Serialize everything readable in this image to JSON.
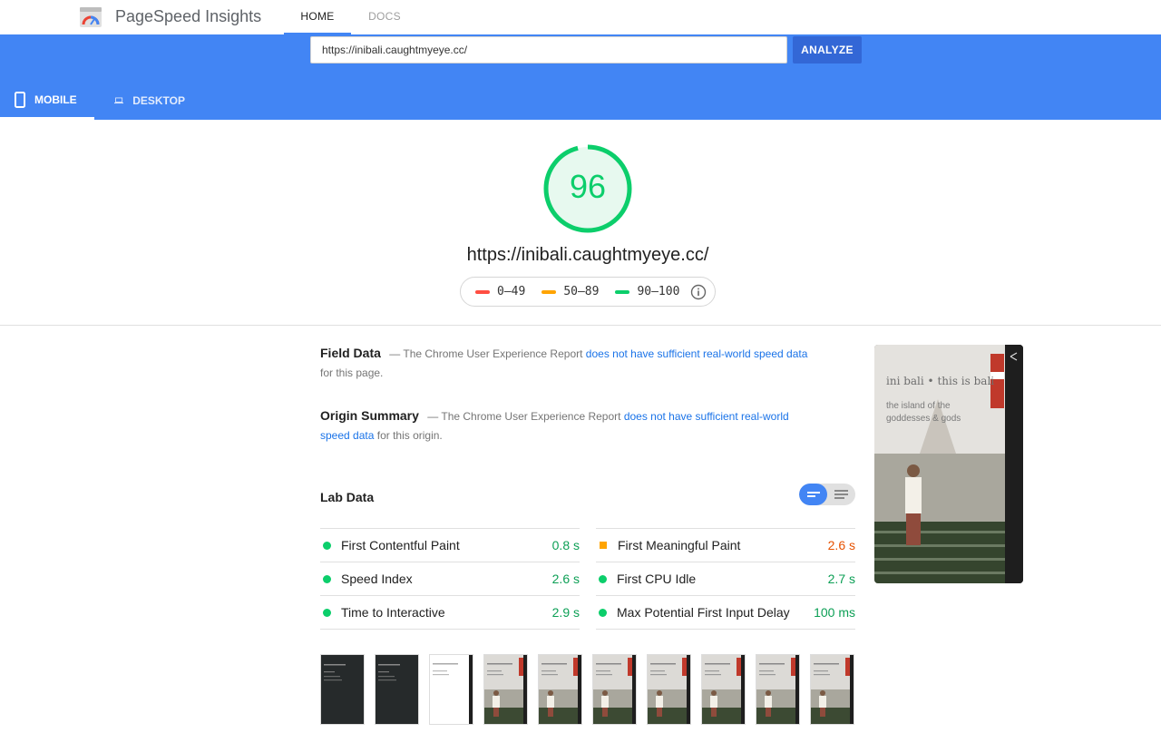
{
  "header": {
    "app_title": "PageSpeed Insights",
    "tabs": [
      {
        "label": "HOME"
      },
      {
        "label": "DOCS"
      }
    ]
  },
  "search": {
    "url_value": "https://inibali.caughtmyeye.cc/",
    "analyze_label": "ANALYZE"
  },
  "device_tabs": [
    {
      "label": "MOBILE",
      "icon": "smartphone-icon",
      "selected": true
    },
    {
      "label": "DESKTOP",
      "icon": "laptop-icon",
      "selected": false
    }
  ],
  "score": {
    "value": "96",
    "fraction": 0.96,
    "color": "#0cce6b",
    "tested_url": "https://inibali.caughtmyeye.cc/"
  },
  "legend": [
    {
      "label": "0–49",
      "color": "#ff4e42"
    },
    {
      "label": "50–89",
      "color": "#ffa400"
    },
    {
      "label": "90–100",
      "color": "#0cce6b"
    }
  ],
  "field_data": {
    "heading": "Field Data",
    "text_before": "— The Chrome User Experience Report",
    "link": "does not have sufficient real-world speed data",
    "text_after": "for this page."
  },
  "origin_summary": {
    "heading": "Origin Summary",
    "text_before": "— The Chrome User Experience Report",
    "link": "does not have sufficient real-world speed data",
    "text_after": "for this origin."
  },
  "lab_data": {
    "heading": "Lab Data",
    "metrics_left": [
      {
        "name": "First Contentful Paint",
        "value": "0.8 s",
        "status": "good"
      },
      {
        "name": "Speed Index",
        "value": "2.6 s",
        "status": "good"
      },
      {
        "name": "Time to Interactive",
        "value": "2.9 s",
        "status": "good"
      }
    ],
    "metrics_right": [
      {
        "name": "First Meaningful Paint",
        "value": "2.6 s",
        "status": "average"
      },
      {
        "name": "First CPU Idle",
        "value": "2.7 s",
        "status": "good"
      },
      {
        "name": "Max Potential First Input Delay",
        "value": "100 ms",
        "status": "good"
      }
    ]
  },
  "final_screenshot": {
    "title": "ini bali • this is bali",
    "subtitle_line1": "the island of the",
    "subtitle_line2": "goddesses & gods"
  },
  "filmstrip": [
    {
      "style": "dark"
    },
    {
      "style": "dark"
    },
    {
      "style": "white"
    },
    {
      "style": "photo"
    },
    {
      "style": "photo"
    },
    {
      "style": "photo"
    },
    {
      "style": "photo"
    },
    {
      "style": "photo"
    },
    {
      "style": "photo"
    },
    {
      "style": "photo"
    }
  ]
}
